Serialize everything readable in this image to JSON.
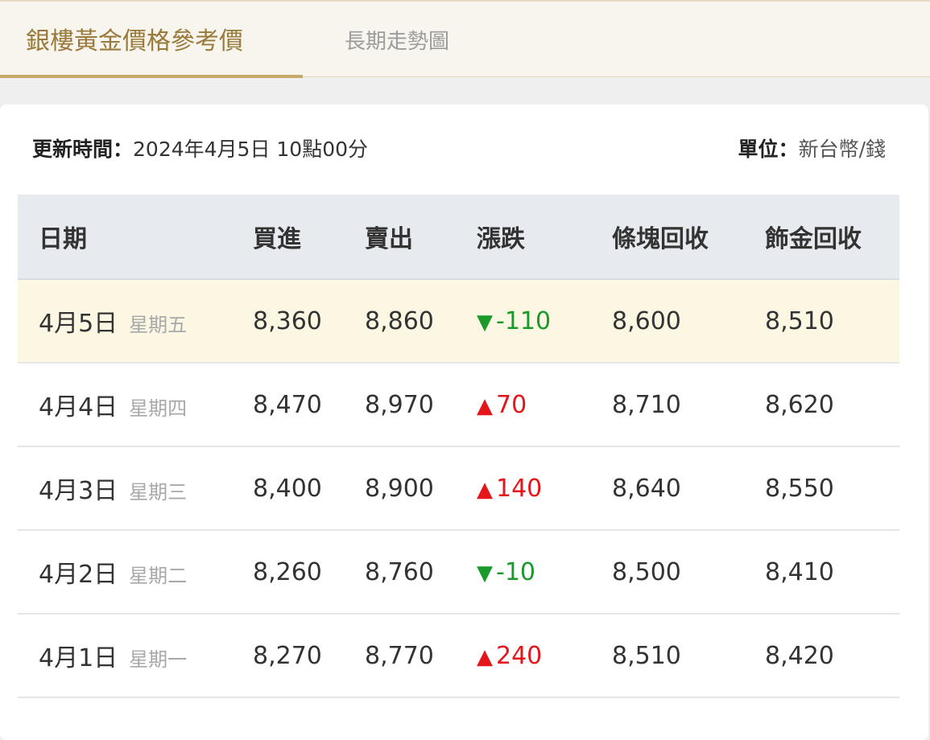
{
  "tabs": {
    "active_label": "銀樓黃金價格參考價",
    "inactive_label": "長期走勢圖"
  },
  "meta": {
    "update_label": "更新時間：",
    "update_value": "2024年4月5日 10點00分",
    "unit_label": "單位：",
    "unit_value": "新台幣/錢"
  },
  "table": {
    "headers": {
      "date": "日期",
      "buy": "買進",
      "sell": "賣出",
      "change": "漲跌",
      "bar_recycle": "條塊回收",
      "ornament_recycle": "飾金回收"
    },
    "rows": [
      {
        "date": "4月5日",
        "weekday": "星期五",
        "buy": "8,360",
        "sell": "8,860",
        "direction": "down",
        "arrow": "▼",
        "change": "-110",
        "bar": "8,600",
        "ornament": "8,510"
      },
      {
        "date": "4月4日",
        "weekday": "星期四",
        "buy": "8,470",
        "sell": "8,970",
        "direction": "up",
        "arrow": "▲",
        "change": "70",
        "bar": "8,710",
        "ornament": "8,620"
      },
      {
        "date": "4月3日",
        "weekday": "星期三",
        "buy": "8,400",
        "sell": "8,900",
        "direction": "up",
        "arrow": "▲",
        "change": "140",
        "bar": "8,640",
        "ornament": "8,550"
      },
      {
        "date": "4月2日",
        "weekday": "星期二",
        "buy": "8,260",
        "sell": "8,760",
        "direction": "down",
        "arrow": "▼",
        "change": "-10",
        "bar": "8,500",
        "ornament": "8,410"
      },
      {
        "date": "4月1日",
        "weekday": "星期一",
        "buy": "8,270",
        "sell": "8,770",
        "direction": "up",
        "arrow": "▲",
        "change": "240",
        "bar": "8,510",
        "ornament": "8,420"
      }
    ]
  },
  "colors": {
    "up": "#e4161b",
    "down": "#1a9a2a",
    "accent": "#c9a96a",
    "highlight_row": "#fcf7e3"
  }
}
